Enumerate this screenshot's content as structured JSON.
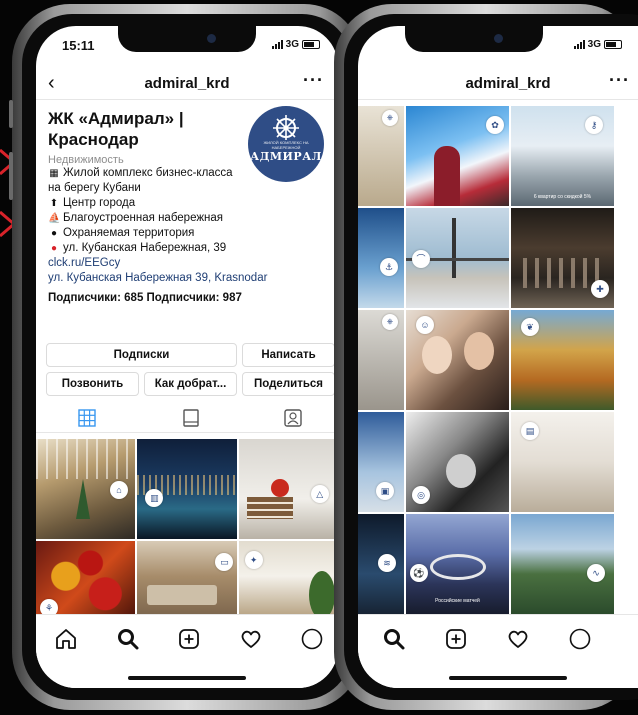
{
  "left_phone": {
    "status": {
      "time": "15:11",
      "network": "3G"
    },
    "header": {
      "title": "admiral_krd",
      "more": "···"
    },
    "profile": {
      "name": "ЖК «Адмирал» | Краснодар",
      "avatar_brand": "АДМИРАЛ",
      "avatar_tagline": "ЖИЛОЙ КОМПЛЕКС НА НАБЕРЕЖНОЙ",
      "category": "Недвижимость",
      "bio": [
        {
          "icon": "building-icon",
          "glyph": "▦",
          "text": "Жилой комплекс бизнес-класса"
        },
        {
          "icon": "",
          "glyph": "",
          "text": "на берегу Кубани"
        },
        {
          "icon": "top-icon",
          "glyph": "⬆",
          "text": "Центр города"
        },
        {
          "icon": "sailboat-icon",
          "glyph": "⛵",
          "text": "Благоустроенная набережная"
        },
        {
          "icon": "guard-icon",
          "glyph": "●",
          "text": "Охраняемая территория"
        },
        {
          "icon": "pin-icon",
          "glyph": "📍",
          "text": "ул. Кубанская Набережная, 39"
        }
      ],
      "link": "clck.ru/EEGcy",
      "address_link": "ул. Кубанская Набережная 39, Krasnodar",
      "stats": "Подписчики: 685  Подписчики: 987"
    },
    "buttons": {
      "subscriptions": "Подписки",
      "message": "Написать",
      "call": "Позвонить",
      "directions": "Как добрат...",
      "share": "Поделиться"
    }
  },
  "right_phone": {
    "status": {
      "network": "3G"
    },
    "header": {
      "title": "admiral_krd",
      "more": "···"
    },
    "grid_captions": {
      "tile_3": "6 квартир со скидкой 5%",
      "tile_14": "Российские матчей"
    }
  },
  "colors": {
    "accent_blue": "#3897f0",
    "brand_navy": "#2f4d86",
    "link": "#1f3e74",
    "decor_red": "#d8232a"
  }
}
